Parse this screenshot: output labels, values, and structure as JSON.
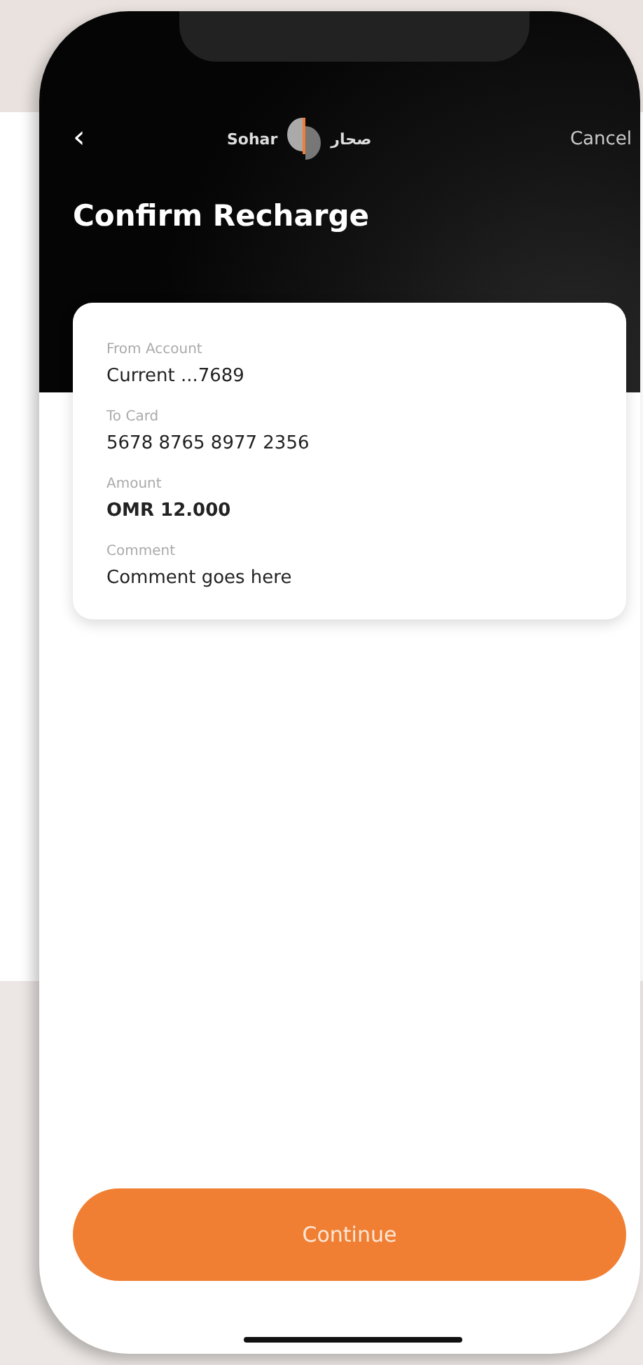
{
  "header": {
    "back": "‹",
    "logo_latin": "Sohar",
    "logo_arabic": "صحار",
    "cancel": "Cancel",
    "title": "Confirm Recharge"
  },
  "details": [
    {
      "label": "From Account",
      "value": "Current ...7689",
      "emphasis": false
    },
    {
      "label": "To Card",
      "value": "5678 8765 8977 2356",
      "emphasis": false
    },
    {
      "label": "Amount",
      "value": "OMR 12.000",
      "emphasis": true
    },
    {
      "label": "Comment",
      "value": "Comment goes here",
      "emphasis": false
    }
  ],
  "button": "Continue"
}
